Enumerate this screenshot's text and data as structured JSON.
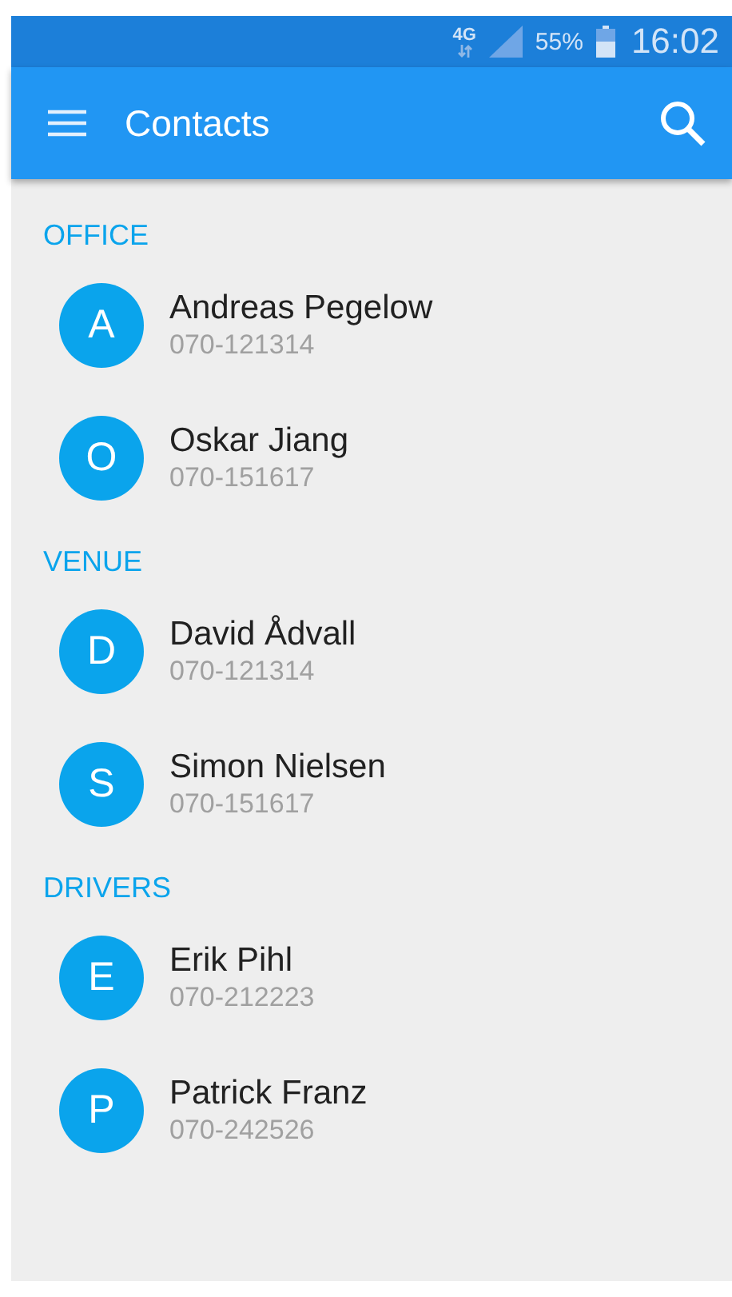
{
  "status_bar": {
    "network": "4G",
    "battery": "55%",
    "time": "16:02"
  },
  "app_bar": {
    "title": "Contacts"
  },
  "groups": [
    {
      "label": "OFFICE",
      "contacts": [
        {
          "initial": "A",
          "name": "Andreas Pegelow",
          "phone": "070-121314"
        },
        {
          "initial": "O",
          "name": "Oskar Jiang",
          "phone": "070-151617"
        }
      ]
    },
    {
      "label": "VENUE",
      "contacts": [
        {
          "initial": "D",
          "name": "David Ådvall",
          "phone": "070-121314"
        },
        {
          "initial": "S",
          "name": "Simon Nielsen",
          "phone": "070-151617"
        }
      ]
    },
    {
      "label": "DRIVERS",
      "contacts": [
        {
          "initial": "E",
          "name": "Erik Pihl",
          "phone": "070-212223"
        },
        {
          "initial": "P",
          "name": "Patrick Franz",
          "phone": "070-242526"
        }
      ]
    }
  ]
}
